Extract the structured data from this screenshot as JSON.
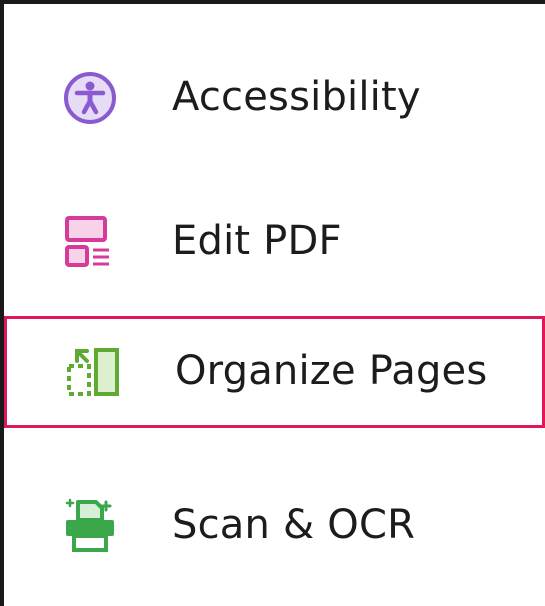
{
  "menu": {
    "items": [
      {
        "label": "Accessibility",
        "icon": "accessibility-icon",
        "color": "#8a5ad0"
      },
      {
        "label": "Edit PDF",
        "icon": "edit-pdf-icon",
        "color": "#d63a9a"
      },
      {
        "label": "Organize Pages",
        "icon": "organize-pages-icon",
        "color": "#5faa32",
        "highlighted": true
      },
      {
        "label": "Scan & OCR",
        "icon": "scan-ocr-icon",
        "color": "#3aa84a"
      }
    ],
    "highlight_color": "#e0185a"
  }
}
